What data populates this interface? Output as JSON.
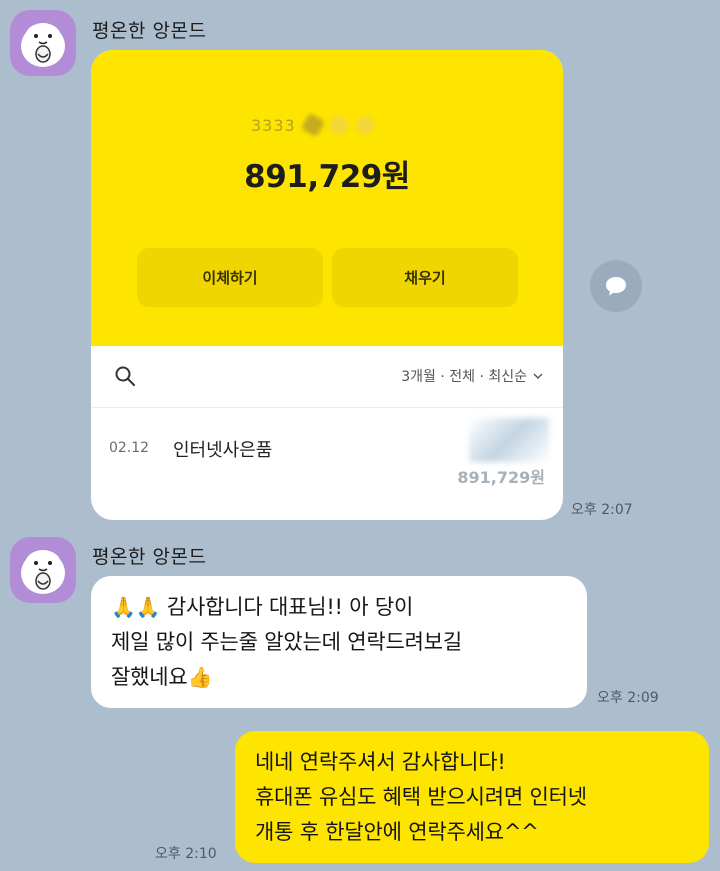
{
  "chat": {
    "sender_name": "평온한 앙몬드",
    "card": {
      "account_prefix": "3333",
      "balance": "891,729원",
      "transfer_button": "이체하기",
      "charge_button": "채우기",
      "filter": "3개월 · 전체 · 최신순",
      "transaction": {
        "date": "02.12",
        "name": "인터넷사은품",
        "amount": "891,729원"
      },
      "time": "오후 2:07"
    },
    "reply": {
      "emoji": "🙏🙏",
      "line1": "감사합니다 대표님!! 아    당이",
      "line2": "제일 많이 주는줄 알았는데 연락드려보길",
      "line3": "잘했네요",
      "line3_emoji": "👍",
      "time": "오후 2:09"
    },
    "mine": {
      "line1": "네네 연락주셔서 감사합니다!",
      "line2": "휴대폰 유심도 혜택 받으시려면 인터넷",
      "line3": "개통 후 한달안에 연락주세요^^",
      "time": "오후 2:10"
    }
  },
  "colors": {
    "background": "#acbdcd",
    "kakao_yellow": "#fee500",
    "avatar_purple": "#b28cd6"
  }
}
